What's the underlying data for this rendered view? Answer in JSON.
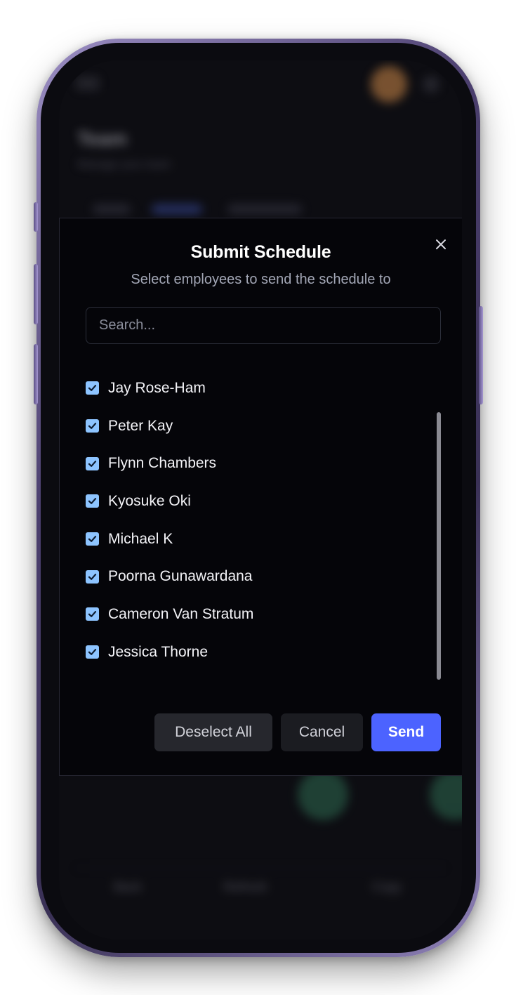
{
  "background_app": {
    "title": "Team",
    "subtitle": "Manage your team",
    "bottom_bar": [
      "Back",
      "Refresh",
      "Copy"
    ]
  },
  "modal": {
    "title": "Submit Schedule",
    "subtitle": "Select employees to send the schedule to",
    "search": {
      "placeholder": "Search...",
      "value": ""
    },
    "employees": [
      {
        "name": "Jay Rose-Ham",
        "checked": true
      },
      {
        "name": "Peter Kay",
        "checked": true
      },
      {
        "name": "Flynn Chambers",
        "checked": true
      },
      {
        "name": "Kyosuke Oki",
        "checked": true
      },
      {
        "name": "Michael K",
        "checked": true
      },
      {
        "name": "Poorna Gunawardana",
        "checked": true
      },
      {
        "name": "Cameron Van Stratum",
        "checked": true
      },
      {
        "name": "Jessica Thorne",
        "checked": true
      }
    ],
    "buttons": {
      "deselect_all": "Deselect All",
      "cancel": "Cancel",
      "send": "Send"
    }
  },
  "colors": {
    "accent": "#4c63ff",
    "checkbox": "#8dc4ff",
    "modal_bg": "#050509"
  },
  "icons": {
    "close": "close-icon",
    "checkbox": "check-icon"
  }
}
